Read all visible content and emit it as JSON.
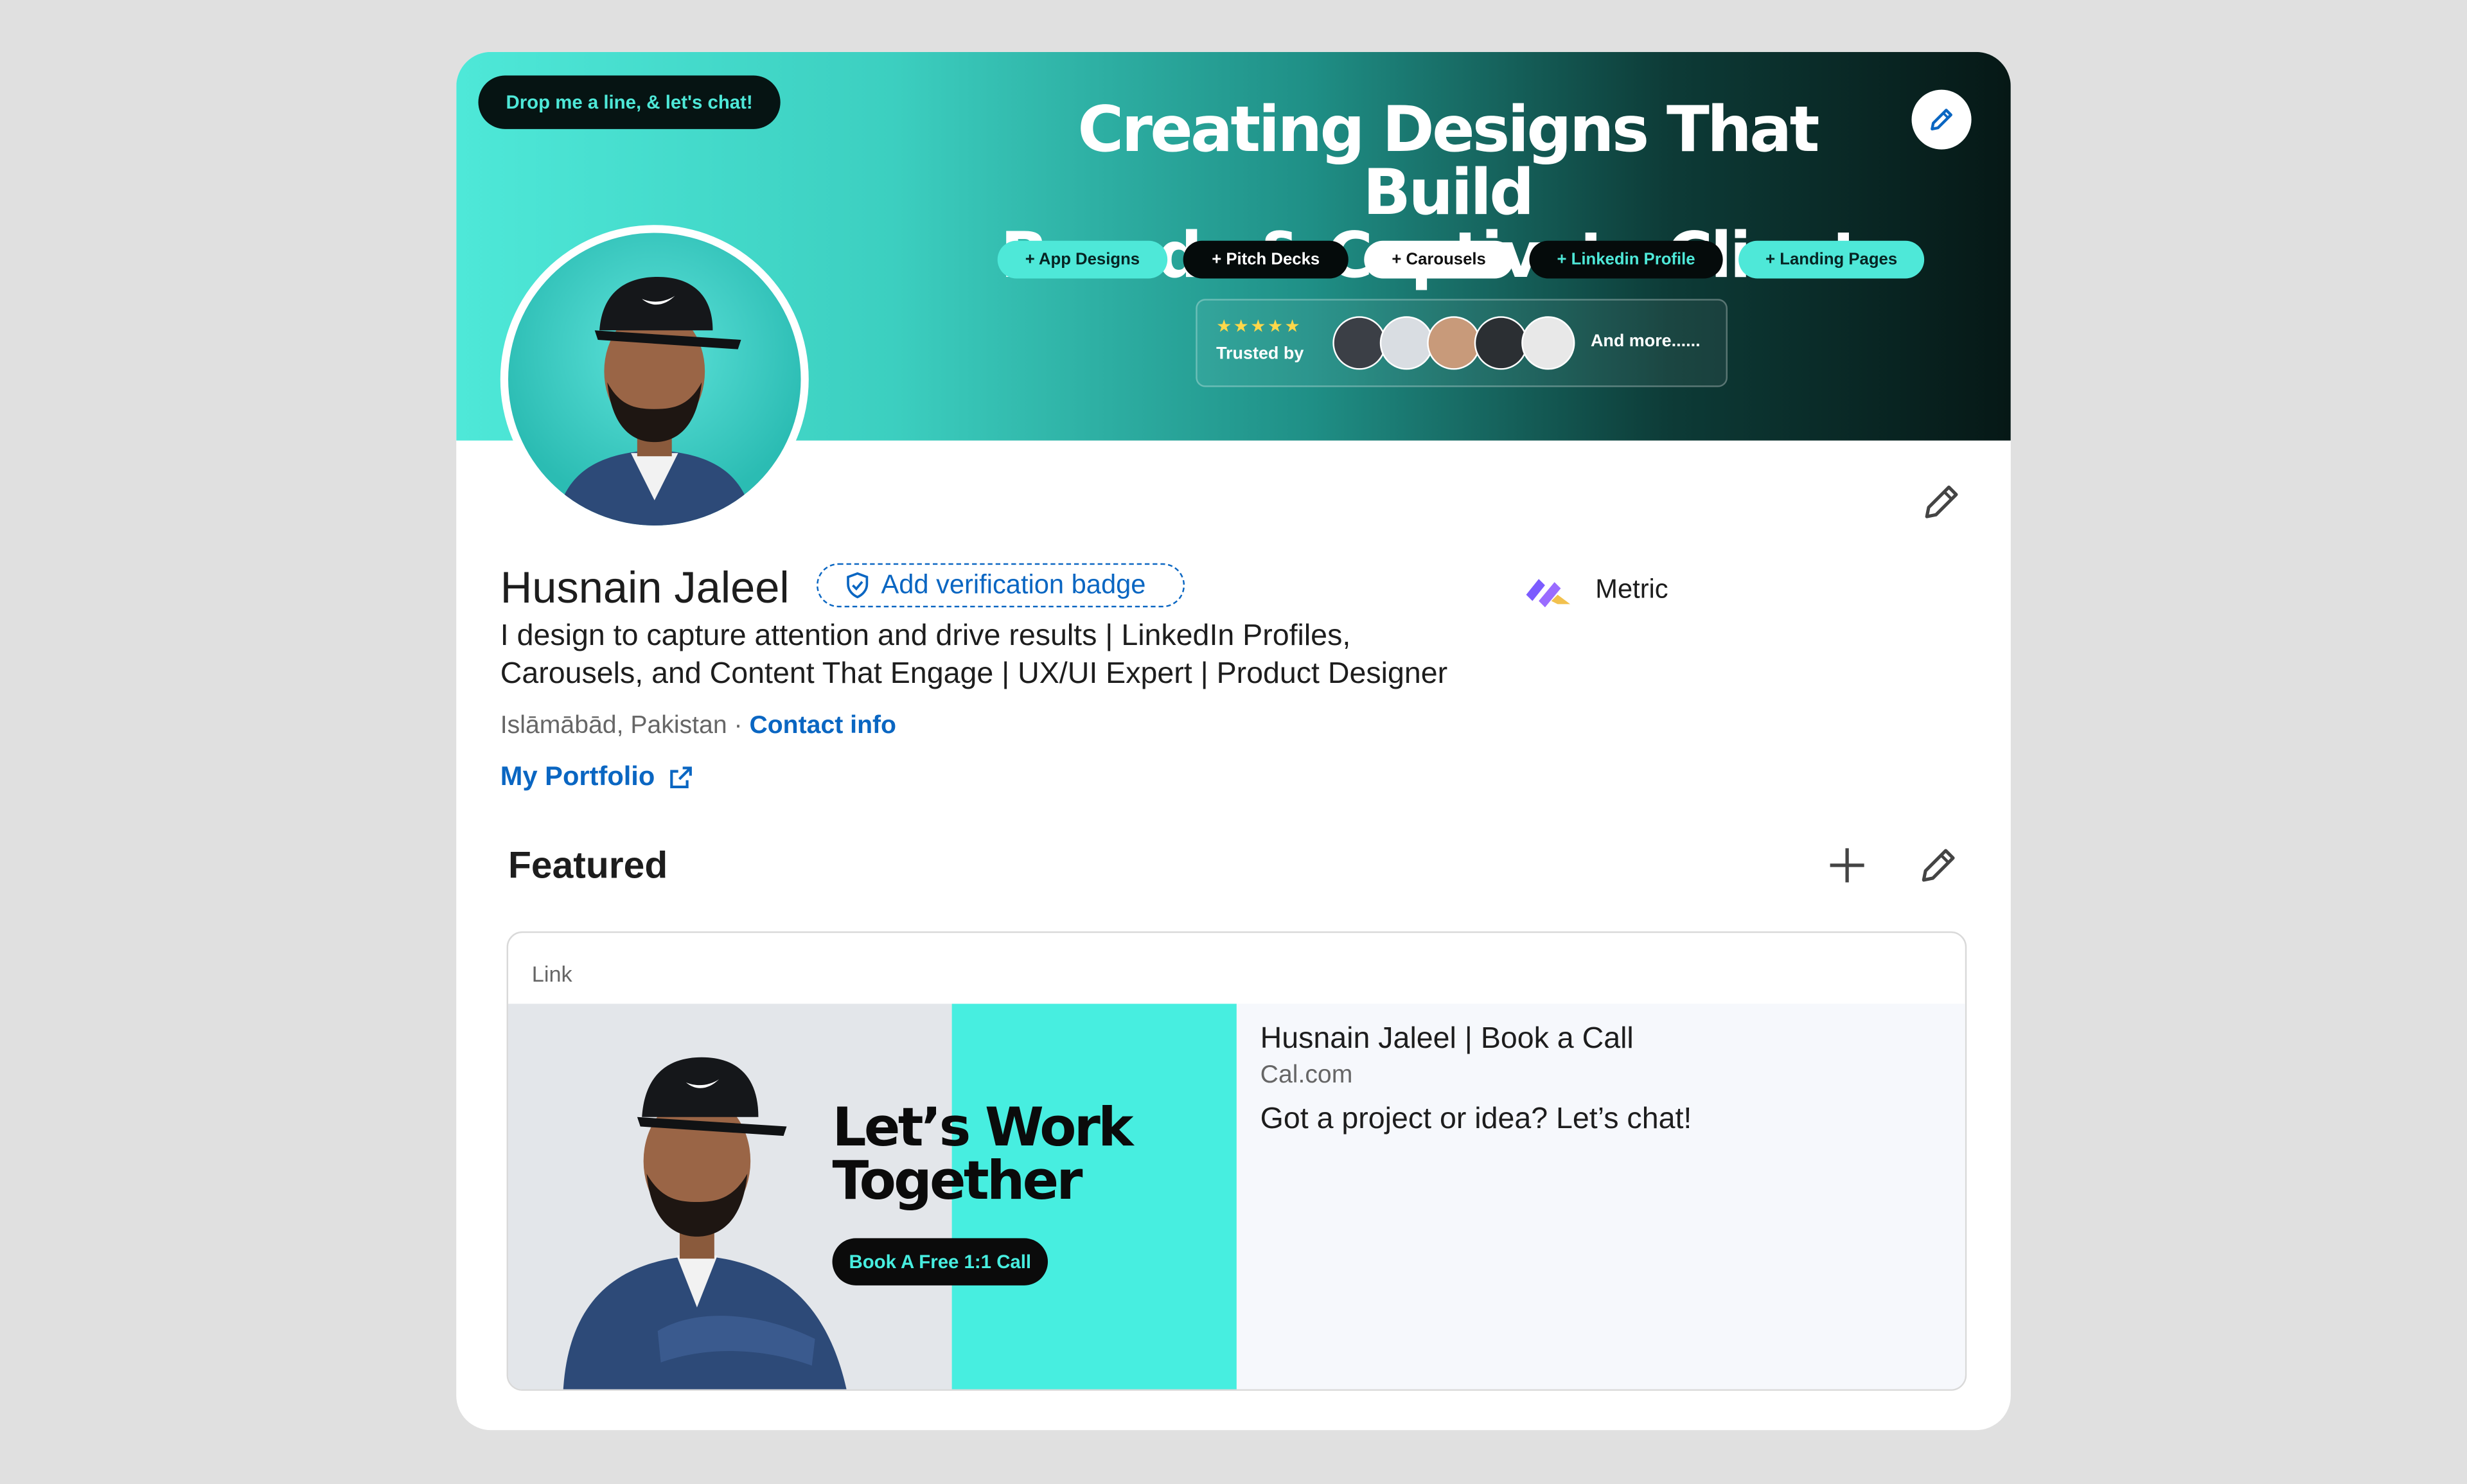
{
  "banner": {
    "chat_pill": "Drop me a line, & let's chat!",
    "headline_line1": "Creating Designs That Build",
    "headline_line2": "Brands & Captivate Clients",
    "tags": [
      "+ App Designs",
      "+ Pitch Decks",
      "+ Carousels",
      "+ Linkedin Profile",
      "+ Landing Pages"
    ],
    "stars": "★★★★★",
    "trusted_label": "Trusted by",
    "more_label": "And more......"
  },
  "profile": {
    "name": "Husnain Jaleel",
    "verify_label": "Add verification badge",
    "company": "Metric",
    "headline": "I design to capture attention and drive results | LinkedIn Profiles, Carousels, and Content That Engage | UX/UI Expert | Product Designer",
    "location": "Islāmābād, Pakistan",
    "separator": " · ",
    "contact_label": "Contact info",
    "portfolio_label": "My Portfolio"
  },
  "featured": {
    "title": "Featured",
    "card": {
      "type": "Link",
      "image_heading_line1": "Let’s Work",
      "image_heading_line2": "Together",
      "image_button": "Book A Free 1:1 Call",
      "name": "Husnain Jaleel | Book a Call",
      "domain": "Cal.com",
      "description": "Got a project or idea? Let’s chat!"
    }
  },
  "colors": {
    "accent": "#0a66c2",
    "teal": "#4ee8d8",
    "dark": "#061413"
  },
  "icons": [
    "pencil-icon",
    "shield-check-icon",
    "plus-icon",
    "external-link-icon",
    "metric-logo-icon"
  ]
}
